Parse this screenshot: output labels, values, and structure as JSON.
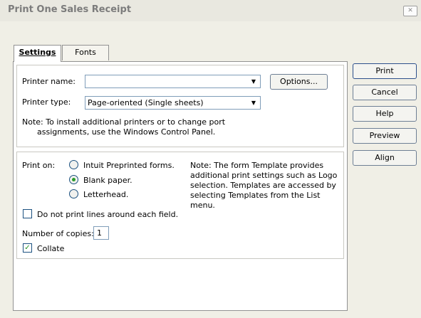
{
  "window": {
    "title": "Print One Sales Receipt",
    "close_glyph": "✕"
  },
  "tabs": [
    {
      "label": "Settings",
      "active": true
    },
    {
      "label": "Fonts",
      "active": false
    }
  ],
  "printer": {
    "name_label": "Printer name:",
    "name_value": "",
    "options_button": "Options...",
    "type_label": "Printer type:",
    "type_value": "Page-oriented (Single sheets)",
    "note_line1": "Note: To install additional printers or to change port",
    "note_line2": "assignments, use the Windows Control Panel."
  },
  "print_on": {
    "label": "Print on:",
    "options": [
      {
        "label": "Intuit Preprinted forms.",
        "selected": false
      },
      {
        "label": "Blank paper.",
        "selected": true
      },
      {
        "label": "Letterhead.",
        "selected": false
      }
    ],
    "note_lines": [
      "Note: The form Template provides",
      "additional print settings such as Logo",
      "selection.  Templates are accessed by",
      "selecting Templates from the List",
      "menu."
    ]
  },
  "options": {
    "no_lines_label": "Do not print lines around each field.",
    "no_lines_checked": false,
    "copies_label": "Number of copies:",
    "copies_value": "1",
    "collate_label": "Collate",
    "collate_checked": true
  },
  "buttons": {
    "print": "Print",
    "cancel": "Cancel",
    "help": "Help",
    "preview": "Preview",
    "align": "Align"
  },
  "icons": {
    "dropdown_arrow": "▼",
    "check": "✓"
  }
}
